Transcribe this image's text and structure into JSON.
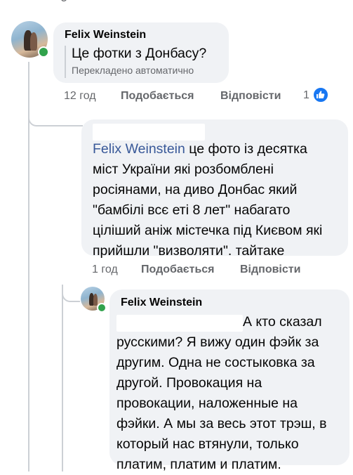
{
  "top_partial_text": "o",
  "comment1": {
    "author": "Felix Weinstein",
    "text": "Це фотки з Донбасу?",
    "translated_note": "Перекладено автоматично",
    "time": "12 год",
    "like_label": "Подобається",
    "reply_label": "Відповісти",
    "reaction_count": "1",
    "reaction_icon": "thumbs-up-icon",
    "reaction_color": "#1877f2"
  },
  "reply1": {
    "mention": "Felix Weinstein",
    "text": " це фото із десятка міст України які розбомблені росіянами, на диво Донбас який \"бамбілі всє еті 8 лет\" набагато ціліший аніж містечка під Києвом які прийшли \"визволяти\". тайтаке",
    "time": "1 год",
    "like_label": "Подобається",
    "reply_label": "Відповісти"
  },
  "reply2": {
    "author": "Felix Weinstein",
    "text": "А кто сказал русскими? Я вижу один фэйк за другим. Одна не состыковка за другой. Провокация на провокации, наложенные на фэйки. А мы за весь этот трэш, в который нас втянули, только платим, платим и платим."
  }
}
